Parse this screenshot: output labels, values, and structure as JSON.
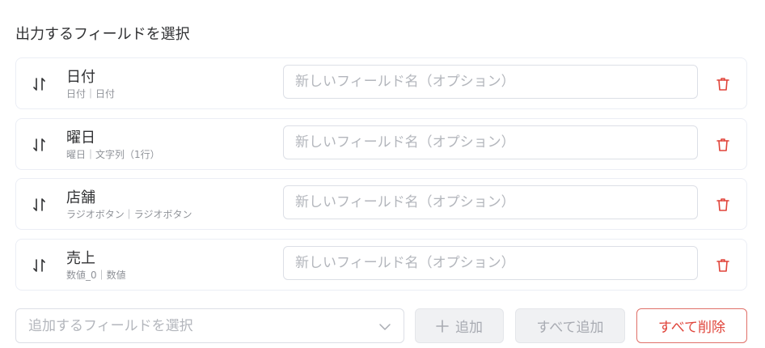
{
  "section": {
    "title": "出力するフィールドを選択"
  },
  "fields": [
    {
      "name": "日付",
      "meta": "日付｜日付",
      "rename_placeholder": "新しいフィールド名（オプション）"
    },
    {
      "name": "曜日",
      "meta": "曜日｜文字列（1行）",
      "rename_placeholder": "新しいフィールド名（オプション）"
    },
    {
      "name": "店舗",
      "meta": "ラジオボタン｜ラジオボタン",
      "rename_placeholder": "新しいフィールド名（オプション）"
    },
    {
      "name": "売上",
      "meta": "数値_0｜数値",
      "rename_placeholder": "新しいフィールド名（オプション）"
    }
  ],
  "add_bar": {
    "select_placeholder": "追加するフィールドを選択",
    "add_label": "追加",
    "add_all_label": "すべて追加",
    "delete_all_label": "すべて削除"
  },
  "colors": {
    "danger": "#e0443a",
    "muted": "#909399",
    "border": "#ebeef5",
    "disabled_text": "#a8abb2"
  },
  "icons": {
    "drag": "sort-arrows-icon",
    "delete": "trash-icon",
    "chevron": "chevron-down-icon",
    "plus": "plus-icon"
  }
}
